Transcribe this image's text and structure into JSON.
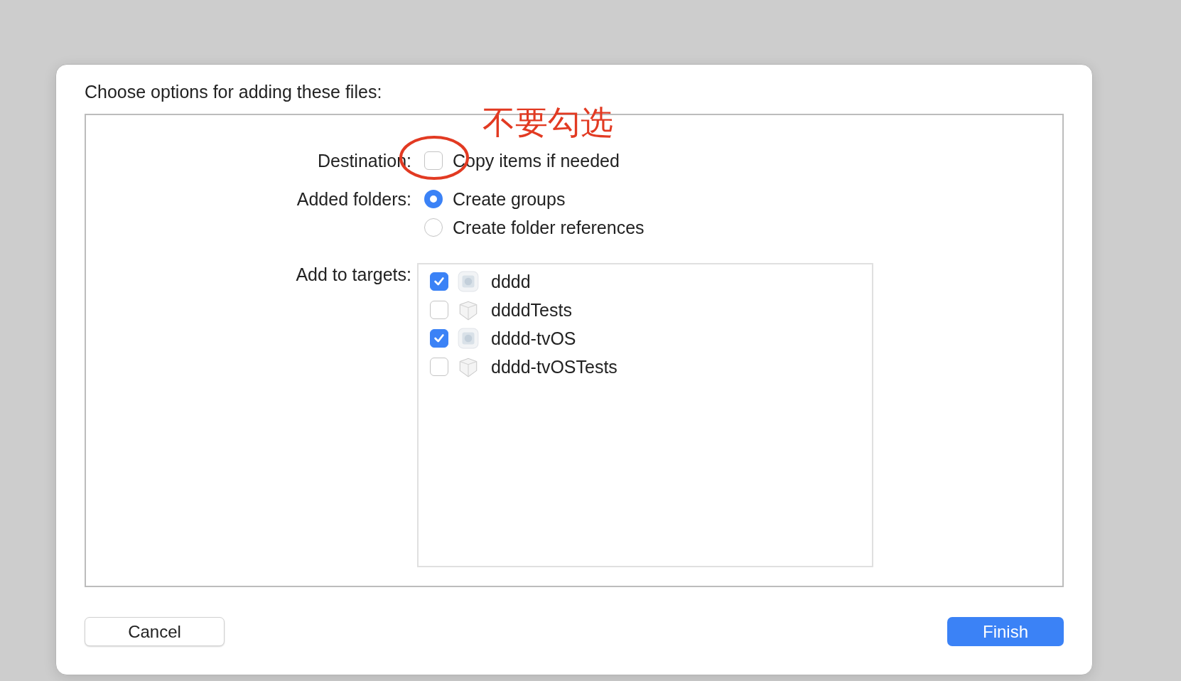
{
  "dialog": {
    "title": "Choose options for adding these files:",
    "destination": {
      "label": "Destination:",
      "option": "Copy items if needed",
      "checked": false
    },
    "annotation": {
      "text": "不要勾选"
    },
    "added_folders": {
      "label": "Added folders:",
      "options": [
        {
          "label": "Create groups",
          "selected": true
        },
        {
          "label": "Create folder references",
          "selected": false
        }
      ]
    },
    "targets": {
      "label": "Add to targets:",
      "items": [
        {
          "name": "dddd",
          "kind": "app",
          "checked": true
        },
        {
          "name": "ddddTests",
          "kind": "test",
          "checked": false
        },
        {
          "name": "dddd-tvOS",
          "kind": "app",
          "checked": true
        },
        {
          "name": "dddd-tvOSTests",
          "kind": "test",
          "checked": false
        }
      ]
    },
    "buttons": [
      {
        "label": "Cancel",
        "kind": "secondary"
      },
      {
        "label": "Finish",
        "kind": "primary"
      }
    ]
  }
}
